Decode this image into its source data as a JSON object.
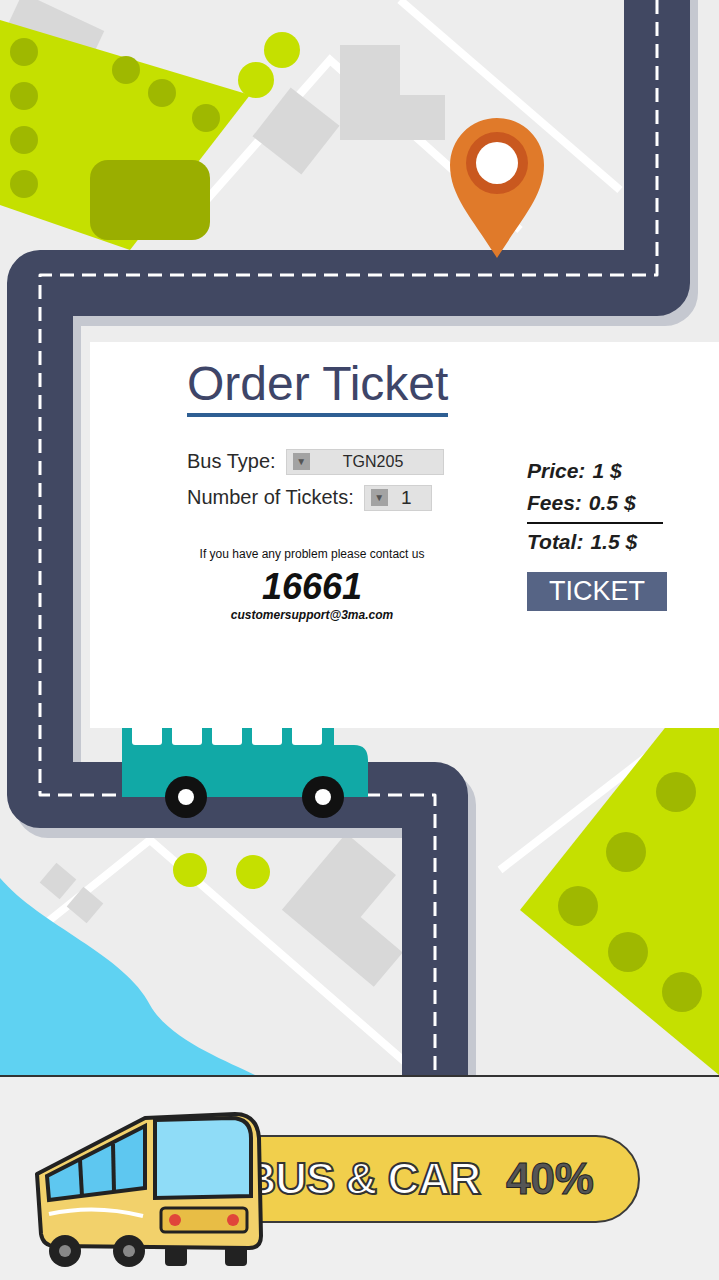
{
  "title": "Order Ticket",
  "form": [
    {
      "label": "Bus Type:",
      "arrow": "▼",
      "value": "TGN205"
    },
    {
      "label": "Number of Tickets:",
      "arrow": "▼",
      "value": "1"
    }
  ],
  "contact": {
    "message": "If you have any problem please contact us",
    "phone": "16661",
    "email": "customersupport@3ma.com"
  },
  "summary": {
    "lines": [
      {
        "label": "Price:",
        "value": "1 $"
      },
      {
        "label": "Fees:",
        "value": "0.5 $"
      }
    ],
    "total": {
      "label": "Total:",
      "value": "1.5 $"
    }
  },
  "button": "TICKET",
  "banner": {
    "text": "BUS & CAR",
    "discount": "40%"
  }
}
